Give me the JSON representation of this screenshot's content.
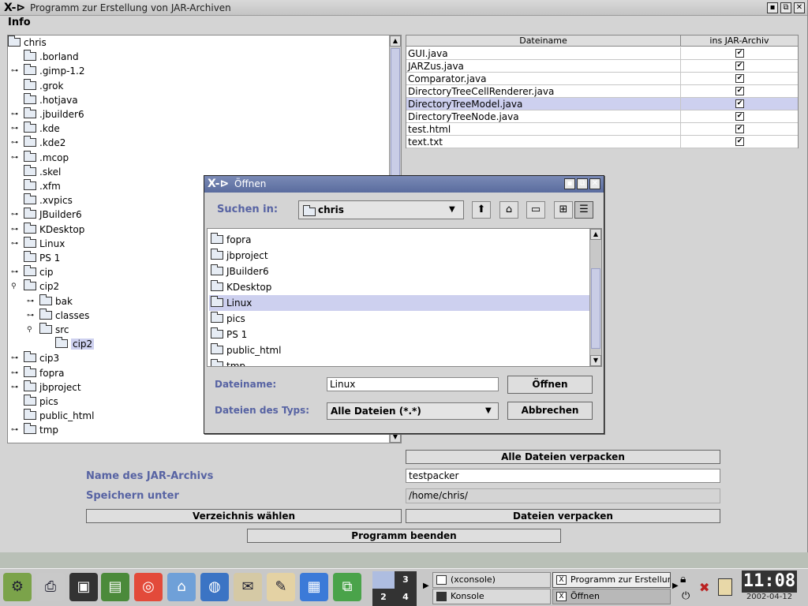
{
  "main_window": {
    "title": "Programm zur Erstellung von JAR-Archiven",
    "logo": "X-⊳",
    "controls": [
      "▪",
      "⧉",
      "✕"
    ],
    "menu": [
      "Info"
    ]
  },
  "tree": {
    "root": "chris",
    "items": [
      {
        "label": ".borland"
      },
      {
        "label": ".gimp-1.2"
      },
      {
        "label": ".grok"
      },
      {
        "label": ".hotjava"
      },
      {
        "label": ".jbuilder6"
      },
      {
        "label": ".kde"
      },
      {
        "label": ".kde2"
      },
      {
        "label": ".mcop"
      },
      {
        "label": ".skel"
      },
      {
        "label": ".xfm"
      },
      {
        "label": ".xvpics"
      },
      {
        "label": "JBuilder6"
      },
      {
        "label": "KDesktop"
      },
      {
        "label": "Linux"
      },
      {
        "label": "PS 1"
      },
      {
        "label": "cip"
      },
      {
        "label": "cip2"
      },
      {
        "label": "bak"
      },
      {
        "label": "classes"
      },
      {
        "label": "src"
      },
      {
        "label": "cip2"
      },
      {
        "label": "cip3"
      },
      {
        "label": "fopra"
      },
      {
        "label": "jbproject"
      },
      {
        "label": "pics"
      },
      {
        "label": "public_html"
      },
      {
        "label": "tmp"
      }
    ],
    "selected": "cip2"
  },
  "table": {
    "headers": [
      "Dateiname",
      "ins JAR-Archiv"
    ],
    "check_mark": "✔",
    "rows": [
      {
        "name": "GUI.java",
        "checked": true
      },
      {
        "name": "JARZus.java",
        "checked": true
      },
      {
        "name": "Comparator.java",
        "checked": true
      },
      {
        "name": "DirectoryTreeCellRenderer.java",
        "checked": true
      },
      {
        "name": "DirectoryTreeModel.java",
        "checked": true,
        "selected": true
      },
      {
        "name": "DirectoryTreeNode.java",
        "checked": true
      },
      {
        "name": "test.html",
        "checked": true
      },
      {
        "name": "text.txt",
        "checked": true
      }
    ]
  },
  "form": {
    "pack_all_label": "Alle Dateien verpacken",
    "archive_name_label": "Name des JAR-Archivs",
    "archive_name_value": "testpacker",
    "save_under_label": "Speichern unter",
    "save_under_value": "/home/chris/",
    "choose_dir_label": "Verzeichnis wählen",
    "pack_files_label": "Dateien verpacken",
    "quit_label": "Programm beenden"
  },
  "dialog": {
    "title": "Öffnen",
    "look_in_label": "Suchen in:",
    "look_in_value": "chris",
    "toolbar_icons": [
      "up-folder-icon",
      "home-icon",
      "new-folder-icon",
      "list-view-icon",
      "details-view-icon"
    ],
    "files": [
      {
        "label": "fopra"
      },
      {
        "label": "jbproject"
      },
      {
        "label": "JBuilder6"
      },
      {
        "label": "KDesktop"
      },
      {
        "label": "Linux",
        "selected": true
      },
      {
        "label": "pics"
      },
      {
        "label": "PS 1"
      },
      {
        "label": "public_html"
      },
      {
        "label": "tmp"
      }
    ],
    "filename_label": "Dateiname:",
    "filename_value": "Linux",
    "filetype_label": "Dateien des Typs:",
    "filetype_value": "Alle Dateien (*.*)",
    "open_button": "Öffnen",
    "cancel_button": "Abbrechen"
  },
  "taskbar": {
    "pager": [
      "3",
      "2",
      "4"
    ],
    "tasks": [
      {
        "label": "(xconsole)"
      },
      {
        "label": "Programm zur Erstellung v"
      },
      {
        "label": "Konsole"
      },
      {
        "label": "Öffnen"
      }
    ],
    "clock_time": "11:08",
    "clock_date": "2002-04-12"
  }
}
